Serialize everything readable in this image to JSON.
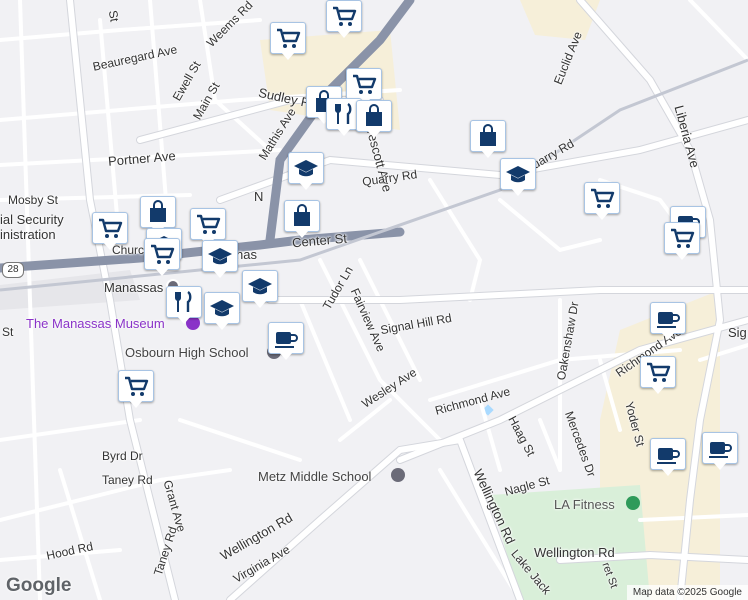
{
  "map": {
    "attribution": "Map data ©2025 Google",
    "logo": "Google",
    "colors": {
      "background": "#f1f1f4",
      "road": "#ffffff",
      "road_outline": "#d4d6dc",
      "highway": "#8a93a8",
      "commercial": "#f6efd9",
      "park": "#d9efd9",
      "water": "#aadaff",
      "pin_icon": "#123a6b",
      "school_label": "#444444",
      "museum_label": "#8a33c8"
    },
    "road_labels": {
      "st_top": "St",
      "weems_rd": "Weems Rd",
      "beauregard_ave": "Beauregard Ave",
      "ewell_st": "Ewell St",
      "main_st": "Main St",
      "sudley_rd": "Sudley Rd",
      "mathis_ave": "Mathis Ave",
      "prescott_ave": "Prescott Ave",
      "portner_ave": "Portner Ave",
      "mosby_st": "Mosby St",
      "quarry_rd": "Quarry Rd",
      "quarry_rd_east": "uarry Rd",
      "euclid_ave": "Euclid Ave",
      "liberia_ave": "Liberia Ave",
      "liberia_ave_south": "Liberia Ave",
      "center_st": "Center St",
      "church": "Church",
      "manassas_short": "nas",
      "social_security_1": "ial Security",
      "social_security_2": "inistration",
      "route_28": "28",
      "tudor_ln": "Tudor Ln",
      "fairview_ave": "Fairview Ave",
      "signal_hill_rd": "Signal Hill Rd",
      "oakenshaw_dr": "Oakenshaw Dr",
      "richmond_ave_east": "Richmond Ave",
      "richmond_ave": "Richmond Ave",
      "sig_edge": "Sig",
      "yoder_st": "Yoder St",
      "wesley_ave": "Wesley Ave",
      "haag_st": "Haag St",
      "mercedes_dr": "Mercedes Dr",
      "byrd_dr": "Byrd Dr",
      "taney_rd": "Taney Rd",
      "taney_rd_south": "Taney Rd",
      "grant_ave": "Grant Ave",
      "nagle_st": "Nagle St",
      "wellington_rd": "Wellington Rd",
      "wellington_rd_center": "Wellington Rd",
      "wellington_rd_east": "Wellington Rd",
      "hood_rd": "Hood Rd",
      "virginia_ave": "Virginia Ave",
      "lake_jack": "Lake Jack",
      "st_left": "St",
      "st_bottom": "ret St"
    },
    "places": {
      "manassas": "Manassas",
      "museum": "The Manassas Museum",
      "osbourn": "Osbourn High School",
      "metz": "Metz Middle School",
      "la_fitness": "LA Fitness",
      "stacked_n": "N"
    },
    "pins": [
      {
        "icon": "cart-icon",
        "name": "cart-pin-1"
      },
      {
        "icon": "cart-icon",
        "name": "cart-pin-2"
      },
      {
        "icon": "cart-icon",
        "name": "cart-pin-3"
      },
      {
        "icon": "bag-icon",
        "name": "bag-pin-1"
      },
      {
        "icon": "fork-knife-icon",
        "name": "restaurant-pin-1"
      },
      {
        "icon": "bag-icon",
        "name": "bag-pin-2"
      },
      {
        "icon": "bag-icon",
        "name": "bag-pin-3"
      },
      {
        "icon": "school-icon",
        "name": "school-pin-1"
      },
      {
        "icon": "school-icon",
        "name": "school-pin-2"
      },
      {
        "icon": "bag-icon",
        "name": "bag-pin-4"
      },
      {
        "icon": "cart-icon",
        "name": "cart-pin-4"
      },
      {
        "icon": "coffee-icon",
        "name": "coffee-pin-1"
      },
      {
        "icon": "cart-icon",
        "name": "cart-pin-5"
      },
      {
        "icon": "cart-icon",
        "name": "cart-pin-6"
      },
      {
        "icon": "bag-icon",
        "name": "bag-pin-5"
      },
      {
        "icon": "cart-icon",
        "name": "cart-pin-7"
      },
      {
        "icon": "school-icon",
        "name": "school-pin-3"
      },
      {
        "icon": "cart-icon",
        "name": "cart-pin-8"
      },
      {
        "icon": "school-icon",
        "name": "school-pin-4"
      },
      {
        "icon": "fork-knife-icon",
        "name": "restaurant-pin-2"
      },
      {
        "icon": "school-icon",
        "name": "school-pin-5"
      },
      {
        "icon": "school-icon",
        "name": "school-pin-6"
      },
      {
        "icon": "coffee-icon",
        "name": "coffee-pin-2"
      },
      {
        "icon": "cart-icon",
        "name": "cart-pin-9"
      },
      {
        "icon": "cart-icon",
        "name": "cart-pin-10"
      },
      {
        "icon": "coffee-icon",
        "name": "coffee-pin-3"
      },
      {
        "icon": "coffee-icon",
        "name": "coffee-pin-4"
      },
      {
        "icon": "coffee-icon",
        "name": "coffee-pin-5"
      }
    ]
  }
}
